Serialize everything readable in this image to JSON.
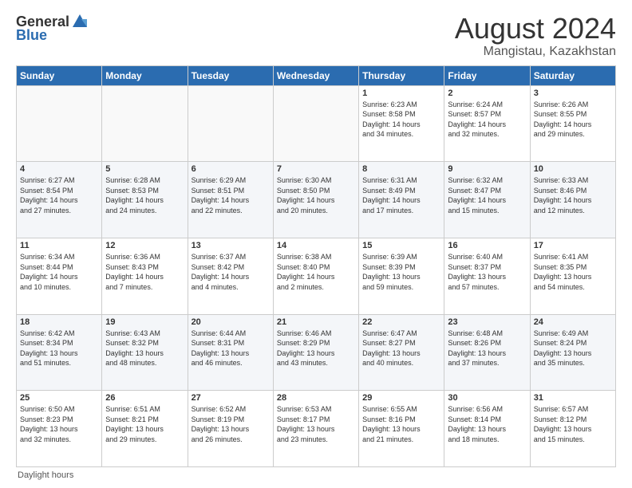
{
  "logo": {
    "general": "General",
    "blue": "Blue"
  },
  "title": "August 2024",
  "location": "Mangistau, Kazakhstan",
  "days_of_week": [
    "Sunday",
    "Monday",
    "Tuesday",
    "Wednesday",
    "Thursday",
    "Friday",
    "Saturday"
  ],
  "footer": "Daylight hours",
  "weeks": [
    [
      {
        "day": "",
        "info": ""
      },
      {
        "day": "",
        "info": ""
      },
      {
        "day": "",
        "info": ""
      },
      {
        "day": "",
        "info": ""
      },
      {
        "day": "1",
        "info": "Sunrise: 6:23 AM\nSunset: 8:58 PM\nDaylight: 14 hours\nand 34 minutes."
      },
      {
        "day": "2",
        "info": "Sunrise: 6:24 AM\nSunset: 8:57 PM\nDaylight: 14 hours\nand 32 minutes."
      },
      {
        "day": "3",
        "info": "Sunrise: 6:26 AM\nSunset: 8:55 PM\nDaylight: 14 hours\nand 29 minutes."
      }
    ],
    [
      {
        "day": "4",
        "info": "Sunrise: 6:27 AM\nSunset: 8:54 PM\nDaylight: 14 hours\nand 27 minutes."
      },
      {
        "day": "5",
        "info": "Sunrise: 6:28 AM\nSunset: 8:53 PM\nDaylight: 14 hours\nand 24 minutes."
      },
      {
        "day": "6",
        "info": "Sunrise: 6:29 AM\nSunset: 8:51 PM\nDaylight: 14 hours\nand 22 minutes."
      },
      {
        "day": "7",
        "info": "Sunrise: 6:30 AM\nSunset: 8:50 PM\nDaylight: 14 hours\nand 20 minutes."
      },
      {
        "day": "8",
        "info": "Sunrise: 6:31 AM\nSunset: 8:49 PM\nDaylight: 14 hours\nand 17 minutes."
      },
      {
        "day": "9",
        "info": "Sunrise: 6:32 AM\nSunset: 8:47 PM\nDaylight: 14 hours\nand 15 minutes."
      },
      {
        "day": "10",
        "info": "Sunrise: 6:33 AM\nSunset: 8:46 PM\nDaylight: 14 hours\nand 12 minutes."
      }
    ],
    [
      {
        "day": "11",
        "info": "Sunrise: 6:34 AM\nSunset: 8:44 PM\nDaylight: 14 hours\nand 10 minutes."
      },
      {
        "day": "12",
        "info": "Sunrise: 6:36 AM\nSunset: 8:43 PM\nDaylight: 14 hours\nand 7 minutes."
      },
      {
        "day": "13",
        "info": "Sunrise: 6:37 AM\nSunset: 8:42 PM\nDaylight: 14 hours\nand 4 minutes."
      },
      {
        "day": "14",
        "info": "Sunrise: 6:38 AM\nSunset: 8:40 PM\nDaylight: 14 hours\nand 2 minutes."
      },
      {
        "day": "15",
        "info": "Sunrise: 6:39 AM\nSunset: 8:39 PM\nDaylight: 13 hours\nand 59 minutes."
      },
      {
        "day": "16",
        "info": "Sunrise: 6:40 AM\nSunset: 8:37 PM\nDaylight: 13 hours\nand 57 minutes."
      },
      {
        "day": "17",
        "info": "Sunrise: 6:41 AM\nSunset: 8:35 PM\nDaylight: 13 hours\nand 54 minutes."
      }
    ],
    [
      {
        "day": "18",
        "info": "Sunrise: 6:42 AM\nSunset: 8:34 PM\nDaylight: 13 hours\nand 51 minutes."
      },
      {
        "day": "19",
        "info": "Sunrise: 6:43 AM\nSunset: 8:32 PM\nDaylight: 13 hours\nand 48 minutes."
      },
      {
        "day": "20",
        "info": "Sunrise: 6:44 AM\nSunset: 8:31 PM\nDaylight: 13 hours\nand 46 minutes."
      },
      {
        "day": "21",
        "info": "Sunrise: 6:46 AM\nSunset: 8:29 PM\nDaylight: 13 hours\nand 43 minutes."
      },
      {
        "day": "22",
        "info": "Sunrise: 6:47 AM\nSunset: 8:27 PM\nDaylight: 13 hours\nand 40 minutes."
      },
      {
        "day": "23",
        "info": "Sunrise: 6:48 AM\nSunset: 8:26 PM\nDaylight: 13 hours\nand 37 minutes."
      },
      {
        "day": "24",
        "info": "Sunrise: 6:49 AM\nSunset: 8:24 PM\nDaylight: 13 hours\nand 35 minutes."
      }
    ],
    [
      {
        "day": "25",
        "info": "Sunrise: 6:50 AM\nSunset: 8:23 PM\nDaylight: 13 hours\nand 32 minutes."
      },
      {
        "day": "26",
        "info": "Sunrise: 6:51 AM\nSunset: 8:21 PM\nDaylight: 13 hours\nand 29 minutes."
      },
      {
        "day": "27",
        "info": "Sunrise: 6:52 AM\nSunset: 8:19 PM\nDaylight: 13 hours\nand 26 minutes."
      },
      {
        "day": "28",
        "info": "Sunrise: 6:53 AM\nSunset: 8:17 PM\nDaylight: 13 hours\nand 23 minutes."
      },
      {
        "day": "29",
        "info": "Sunrise: 6:55 AM\nSunset: 8:16 PM\nDaylight: 13 hours\nand 21 minutes."
      },
      {
        "day": "30",
        "info": "Sunrise: 6:56 AM\nSunset: 8:14 PM\nDaylight: 13 hours\nand 18 minutes."
      },
      {
        "day": "31",
        "info": "Sunrise: 6:57 AM\nSunset: 8:12 PM\nDaylight: 13 hours\nand 15 minutes."
      }
    ]
  ]
}
